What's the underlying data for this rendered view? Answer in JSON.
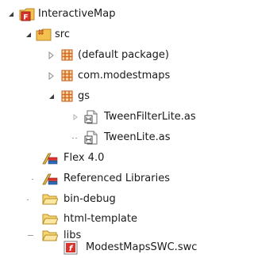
{
  "tree": {
    "project": {
      "label": "InteractiveMap",
      "icon": "flex-project-icon",
      "state": "expanded"
    },
    "src": {
      "label": "src",
      "icon": "source-folder-icon",
      "state": "expanded"
    },
    "default_package": {
      "label": "(default package)",
      "icon": "package-icon",
      "state": "collapsed"
    },
    "com_modestmaps": {
      "label": "com.modestmaps",
      "icon": "package-icon",
      "state": "collapsed"
    },
    "gs": {
      "label": "gs",
      "icon": "package-icon",
      "state": "expanded"
    },
    "tween_filter_lite": {
      "label": "TweenFilterLite.as",
      "icon": "actionscript-file-icon",
      "state": "collapsed"
    },
    "tween_lite": {
      "label": "TweenLite.as",
      "icon": "actionscript-file-icon",
      "state": "leaf"
    },
    "flex_sdk": {
      "label": "Flex 4.0",
      "icon": "library-icon",
      "state": "leaf"
    },
    "referenced_libraries": {
      "label": "Referenced Libraries",
      "icon": "library-icon",
      "state": "leaf"
    },
    "bin_debug": {
      "label": "bin-debug",
      "icon": "folder-icon",
      "state": "leaf"
    },
    "html_template": {
      "label": "html-template",
      "icon": "folder-icon",
      "state": "leaf"
    },
    "libs": {
      "label": "libs",
      "icon": "folder-icon",
      "state": "expanded"
    },
    "modest_maps_swc": {
      "label": "ModestMapsSWC.swc",
      "icon": "swc-file-icon",
      "state": "leaf"
    }
  },
  "colors": {
    "package_orange": "#d2691e",
    "folder_yellow": "#f2c14e",
    "flex_red": "#d8342c",
    "arrow_dark": "#3c3c3c",
    "arrow_outline": "#8a8a8a"
  }
}
